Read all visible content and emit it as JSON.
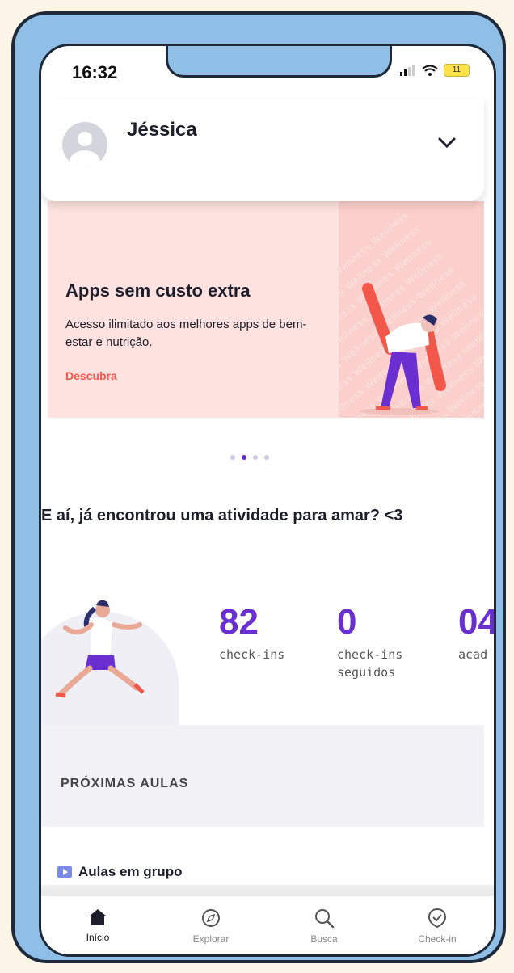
{
  "status_bar": {
    "time": "16:32",
    "battery": "11"
  },
  "header": {
    "user_name": "Jéssica"
  },
  "banner": {
    "title": "Apps sem custo extra",
    "text": "Acesso ilimitado aos melhores apps de bem-estar e nutrição.",
    "link": "Descubra",
    "watermark": "Wellness Wellness Wellness Wellness",
    "pages": 4,
    "active_page": 2
  },
  "question": "E aí, já encontrou uma atividade para amar? <3",
  "stats": [
    {
      "value": "82",
      "label": "check-ins"
    },
    {
      "value": "0",
      "label": "check-ins seguidos"
    },
    {
      "value": "04",
      "label": "acad"
    }
  ],
  "next_classes": {
    "title": "PRÓXIMAS AULAS"
  },
  "group_classes": {
    "label": "Aulas em grupo"
  },
  "tabs": [
    {
      "label": "Início",
      "icon": "home-icon",
      "active": true
    },
    {
      "label": "Explorar",
      "icon": "compass-icon",
      "active": false
    },
    {
      "label": "Busca",
      "icon": "search-icon",
      "active": false
    },
    {
      "label": "Check-in",
      "icon": "checkin-icon",
      "active": false
    }
  ],
  "colors": {
    "accent": "#6a2fd0",
    "link": "#f2574a",
    "frame": "#8fbfe6",
    "banner": "#fde2df"
  }
}
